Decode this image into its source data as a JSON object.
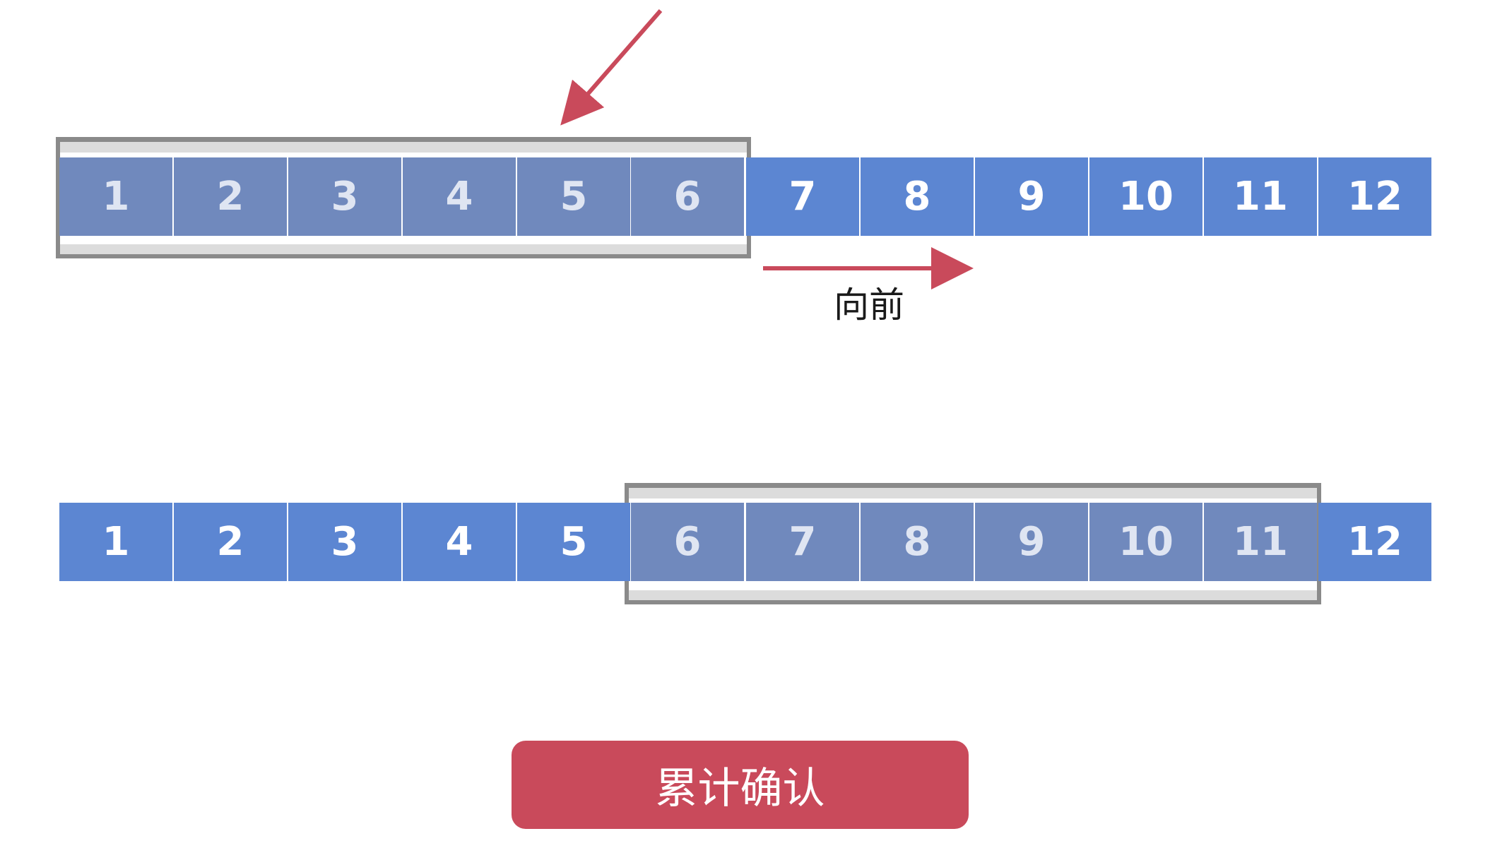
{
  "colors": {
    "cell_blue": "#5c86d2",
    "cell_in_window": "#7089bd",
    "window_border": "#8a8a8a",
    "window_band": "#dcdcdc",
    "arrow_red": "#c94a5b",
    "button_red": "#c94a5b"
  },
  "top_row": {
    "cells": [
      "1",
      "2",
      "3",
      "4",
      "5",
      "6",
      "7",
      "8",
      "9",
      "10",
      "11",
      "12"
    ]
  },
  "bottom_row": {
    "cells": [
      "1",
      "2",
      "3",
      "4",
      "5",
      "6",
      "7",
      "8",
      "9",
      "10",
      "11",
      "12"
    ]
  },
  "forward_label": "向前",
  "button": {
    "label": "累计确认"
  }
}
